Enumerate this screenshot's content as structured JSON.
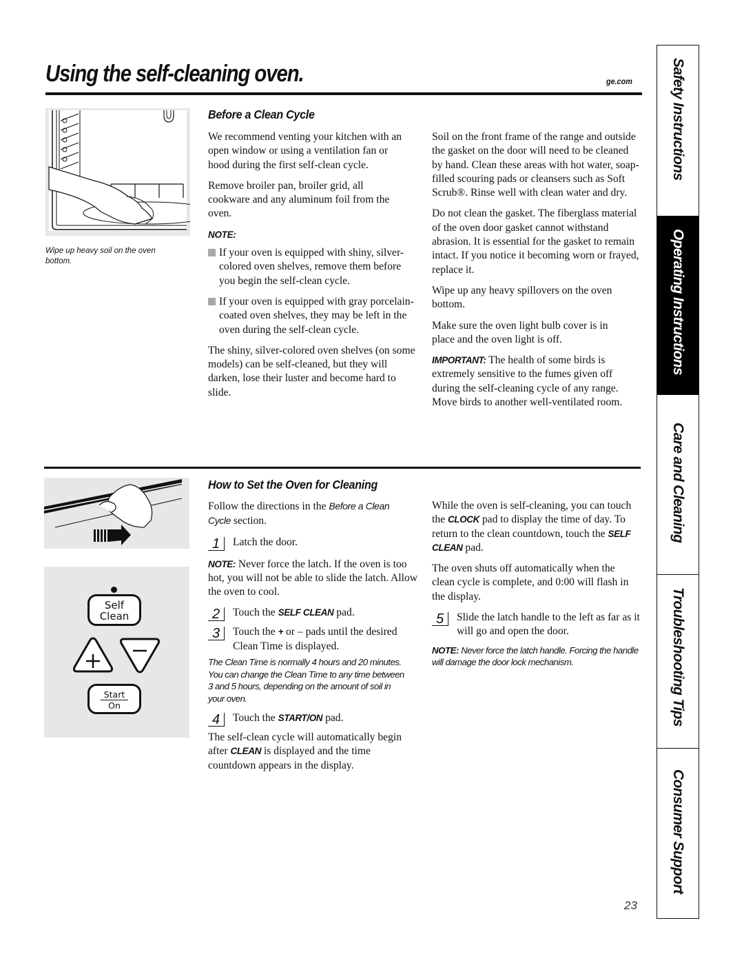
{
  "header": {
    "title": "Using the self-cleaning oven.",
    "site": "ge.com"
  },
  "figures": {
    "oven_wipe": {
      "caption": "Wipe up heavy soil on the oven bottom.",
      "icon": "oven-wipe-illustration"
    },
    "latch": {
      "icon": "door-latch-illustration"
    },
    "control_panel": {
      "self_clean_line1": "Self",
      "self_clean_line2": "Clean",
      "plus": "+",
      "minus": "−",
      "start": "Start",
      "on": "On"
    }
  },
  "before_clean": {
    "heading": "Before a Clean Cycle",
    "left": {
      "p1": "We recommend venting your kitchen with an open window or using a ventilation fan or hood during the first self-clean cycle.",
      "p2": "Remove broiler pan, broiler grid, all cookware and any aluminum foil from the oven.",
      "note_label": "NOTE:",
      "bullets": [
        "If your oven is equipped with shiny, silver-colored oven shelves, remove them before you begin the self-clean cycle.",
        "If your oven is equipped with gray porcelain-coated oven shelves, they may be left in the oven during the self-clean cycle."
      ],
      "p3": "The shiny, silver-colored oven shelves (on some models) can be self-cleaned, but they will darken, lose their luster and become hard to slide."
    },
    "right": {
      "p1": "Soil on the front frame of the range and outside the gasket on the door will need to be cleaned by hand. Clean these areas with hot water, soap-filled scouring pads or cleansers such as Soft Scrub®. Rinse well with clean water and dry.",
      "p2": "Do not clean the gasket. The fiberglass material of the oven door gasket cannot withstand abrasion. It is essential for the gasket to remain intact. If you notice it becoming worn or frayed, replace it.",
      "p3": "Wipe up any heavy spillovers on the oven bottom.",
      "p4": "Make sure the oven light bulb cover is in place and the oven light is off.",
      "important_label": "IMPORTANT:",
      "important_text": " The health of some birds is extremely sensitive to the fumes given off during the self-cleaning cycle of any range. Move birds to another well-ventilated room."
    }
  },
  "how_to_set": {
    "heading": "How to Set the Oven for Cleaning",
    "intro_pre": "Follow the directions in the ",
    "intro_ref": "Before a Clean Cycle",
    "intro_post": " section.",
    "steps": [
      {
        "num": "1",
        "text": "Latch the door."
      },
      {
        "num": "2",
        "pre": "Touch the ",
        "kw": "SELF CLEAN",
        "post": " pad."
      },
      {
        "num": "3",
        "pre": "Touch the ",
        "kw": "+",
        "post": " or – pads until the desired Clean Time is displayed."
      },
      {
        "num": "4",
        "pre": "Touch the ",
        "kw": "START/ON",
        "post": " pad."
      },
      {
        "num": "5",
        "text": "Slide the latch handle to the left as far as it will go and open the door."
      }
    ],
    "note1_label": "NOTE:",
    "note1_text": " Never force the latch. If the oven is too hot, you will not be able to slide the latch. Allow the oven to cool.",
    "clean_time_note": "The Clean Time is normally 4 hours and 20 minutes. You can change the Clean Time to any time between 3 and 5 hours, depending on the amount of soil in your oven.",
    "auto_pre": "The self-clean cycle will automatically begin after ",
    "auto_kw": "CLEAN",
    "auto_post": " is displayed and the time countdown appears in the display.",
    "clock_pre": "While the oven is self-cleaning, you can touch the ",
    "clock_kw": "CLOCK",
    "clock_mid": " pad to display the time of day. To return to the clean countdown, touch the ",
    "clock_kw2": "SELF CLEAN",
    "clock_post": " pad.",
    "shutoff": "The oven shuts off automatically when the clean cycle is complete, and 0:00 will flash in the display.",
    "note2_label": "NOTE:",
    "note2_text": " Never force the latch handle. Forcing the handle will damage the door lock mechanism."
  },
  "side_tabs": [
    {
      "label": "Safety Instructions",
      "active": false
    },
    {
      "label": "Operating Instructions",
      "active": true
    },
    {
      "label": "Care and Cleaning",
      "active": false
    },
    {
      "label": "Troubleshooting Tips",
      "active": false
    },
    {
      "label": "Consumer Support",
      "active": false
    }
  ],
  "page_number": "23"
}
